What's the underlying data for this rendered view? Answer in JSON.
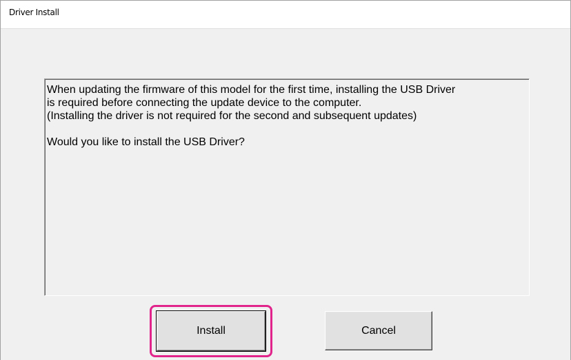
{
  "window": {
    "title": "Driver Install"
  },
  "message": {
    "text": "When updating the firmware of this model for the first time, installing the USB Driver\nis required before connecting the update device to the computer.\n(Installing the driver is not required for the second and subsequent updates)\n\nWould you like to install the USB Driver?"
  },
  "buttons": {
    "install_label": "Install",
    "cancel_label": "Cancel"
  },
  "colors": {
    "highlight": "#e0248c",
    "window_background": "#f0f0f0"
  }
}
